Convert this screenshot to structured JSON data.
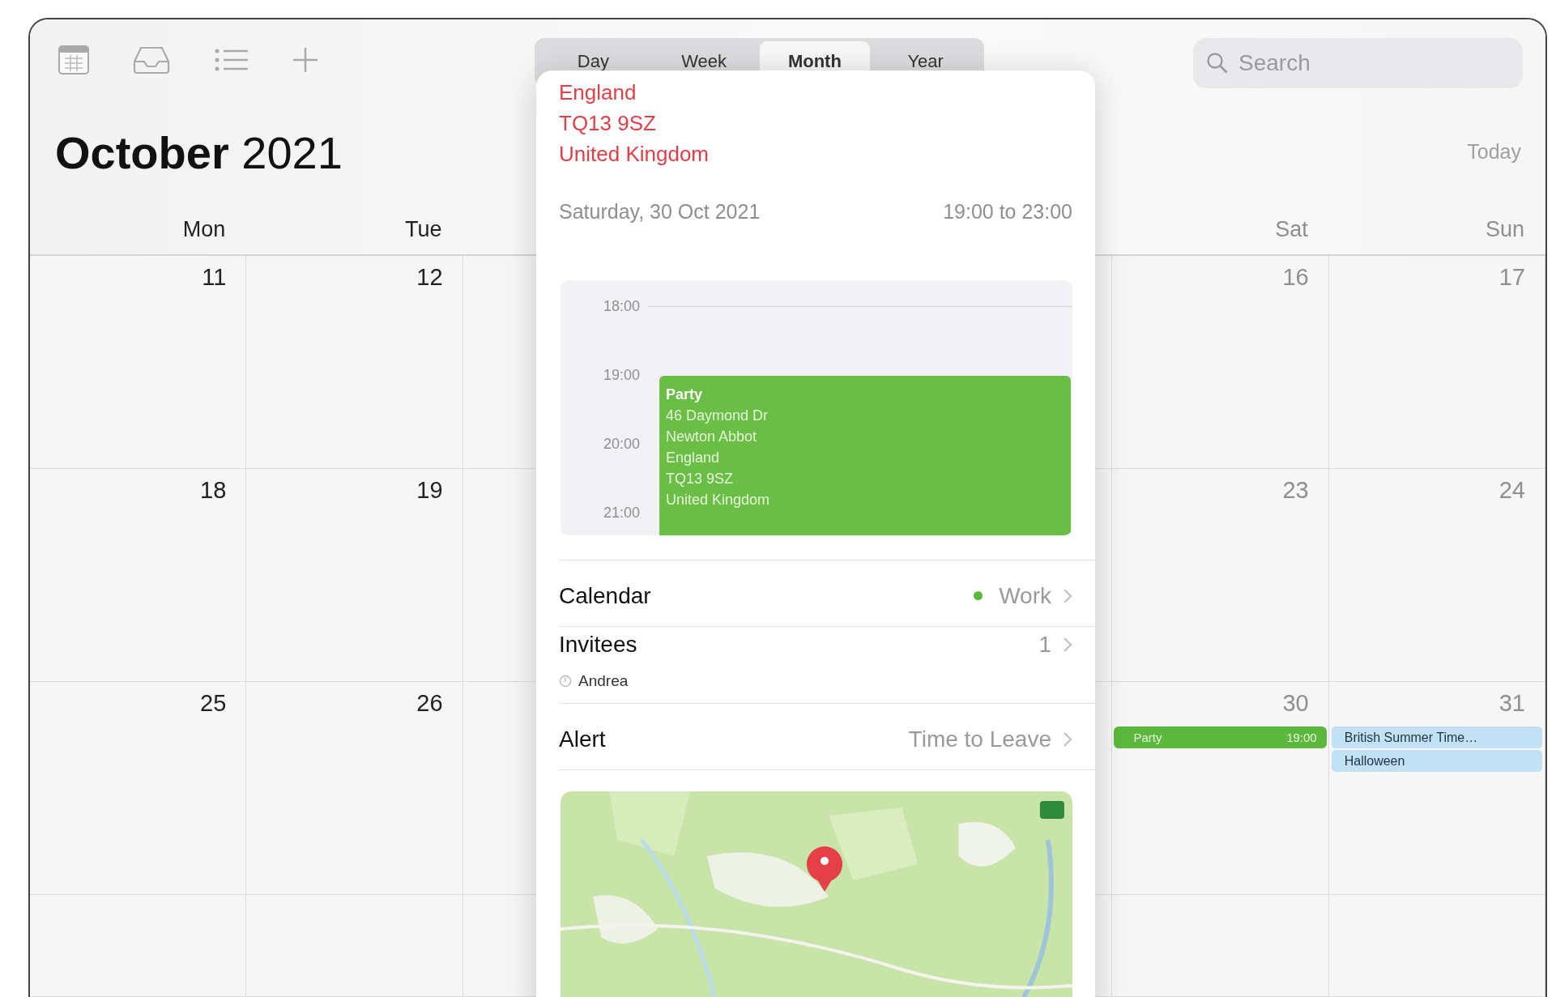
{
  "toolbar": {
    "view_tabs": [
      {
        "label": "Day",
        "selected": false
      },
      {
        "label": "Week",
        "selected": false
      },
      {
        "label": "Month",
        "selected": true
      },
      {
        "label": "Year",
        "selected": false
      }
    ],
    "search": {
      "placeholder": "Search"
    }
  },
  "title": {
    "month": "October",
    "year": "2021"
  },
  "today_button": "Today",
  "day_headers": [
    {
      "label": "Mon",
      "weekend": false
    },
    {
      "label": "Tue",
      "weekend": false
    },
    {
      "label": "Sat",
      "weekend": true
    },
    {
      "label": "Sun",
      "weekend": true
    }
  ],
  "weeks": [
    {
      "days": [
        {
          "number": "11"
        },
        {
          "number": "12"
        },
        {
          "number": "16"
        },
        {
          "number": "17"
        }
      ]
    },
    {
      "days": [
        {
          "number": "18"
        },
        {
          "number": "19"
        },
        {
          "number": "23"
        },
        {
          "number": "24"
        }
      ]
    },
    {
      "days": [
        {
          "number": "25"
        },
        {
          "number": "26"
        },
        {
          "number": "30",
          "events": [
            {
              "kind": "timed",
              "title": "Party",
              "time": "19:00",
              "color": "#5cb83c"
            }
          ]
        },
        {
          "number": "31",
          "events": [
            {
              "kind": "allday",
              "title": "British Summer Time…",
              "color": "#c3e1f5"
            },
            {
              "kind": "allday",
              "title": "Halloween",
              "color": "#c3e1f5"
            }
          ]
        }
      ]
    }
  ],
  "event_popover": {
    "address": [
      "England",
      "TQ13 9SZ",
      "United Kingdom"
    ],
    "date": "Saturday, 30 Oct 2021",
    "time_range": "19:00 to 23:00",
    "timeline": {
      "hours": [
        "18:00",
        "19:00",
        "20:00",
        "21:00"
      ],
      "event": {
        "title": "Party",
        "lines": [
          "46 Daymond Dr",
          "Newton Abbot",
          "England",
          "TQ13 9SZ",
          "United Kingdom"
        ],
        "color": "#6abd45"
      }
    },
    "rows": [
      {
        "kind": "calendar",
        "label": "Calendar",
        "value": "Work",
        "color": "#5cb83c"
      },
      {
        "kind": "invitees",
        "label": "Invitees",
        "value": "1",
        "invitee": "Andrea"
      },
      {
        "kind": "plain",
        "label": "Alert",
        "value": "Time to Leave"
      }
    ],
    "map": {
      "kind": "picture"
    }
  }
}
